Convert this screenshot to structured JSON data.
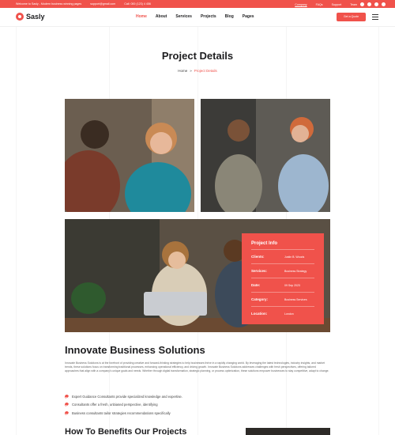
{
  "topbar": {
    "welcome": "Welcome to Sasly - Modern business winning pages",
    "email": "support@gmail.com",
    "phone": "Call: 000 (123) 4 456",
    "links": [
      "Company",
      "FAQs",
      "Support",
      "Team"
    ]
  },
  "header": {
    "logo": "Sasly",
    "nav": [
      {
        "label": "Home",
        "active": true
      },
      {
        "label": "About",
        "active": false
      },
      {
        "label": "Services",
        "active": false
      },
      {
        "label": "Projects",
        "active": false
      },
      {
        "label": "Blog",
        "active": false
      },
      {
        "label": "Pages",
        "active": false
      }
    ],
    "cta": "Get a Quote"
  },
  "hero": {
    "title": "Project Details",
    "breadcrumb": {
      "home": "Home",
      "separator": "»",
      "current": "Project Details"
    }
  },
  "project_info": {
    "title": "Project Info",
    "rows": [
      {
        "key": "Clients:",
        "value": "Justin B. Woods"
      },
      {
        "key": "Services:",
        "value": "Business Strategy"
      },
      {
        "key": "Date:",
        "value": "09 Sep 2023"
      },
      {
        "key": "Category:",
        "value": "Business Services"
      },
      {
        "key": "Location:",
        "value": "London"
      }
    ]
  },
  "content": {
    "heading": "Innovate Business Solutions",
    "paragraph": "Innovate Business Solutions is at the forefront of providing creative and forward-thinking strategies to help businesses thrive in a rapidly changing world. By leveraging the latest technologies, industry insights, and market trends, these solutions focus on transforming traditional processes, enhancing operational efficiency, and driving growth. Innovate Business Solutions addresses challenges with fresh perspectives, offering tailored approaches that align with a company's unique goals and needs. Whether through digital transformation, strategic planning, or process optimization, these solutions empower businesses to stay competitive, adapt to change.",
    "bullets": [
      "Expert Guidance Consultants provide specialized knowledge and expertise.",
      "Consultants offer a fresh, unbiased perspective, identifying",
      "Business consultants tailor strategies recommendations specifically"
    ],
    "subheading": "How To Benefits Our Projects"
  },
  "colors": {
    "accent": "#f0524b",
    "text": "#1d1d1f"
  }
}
